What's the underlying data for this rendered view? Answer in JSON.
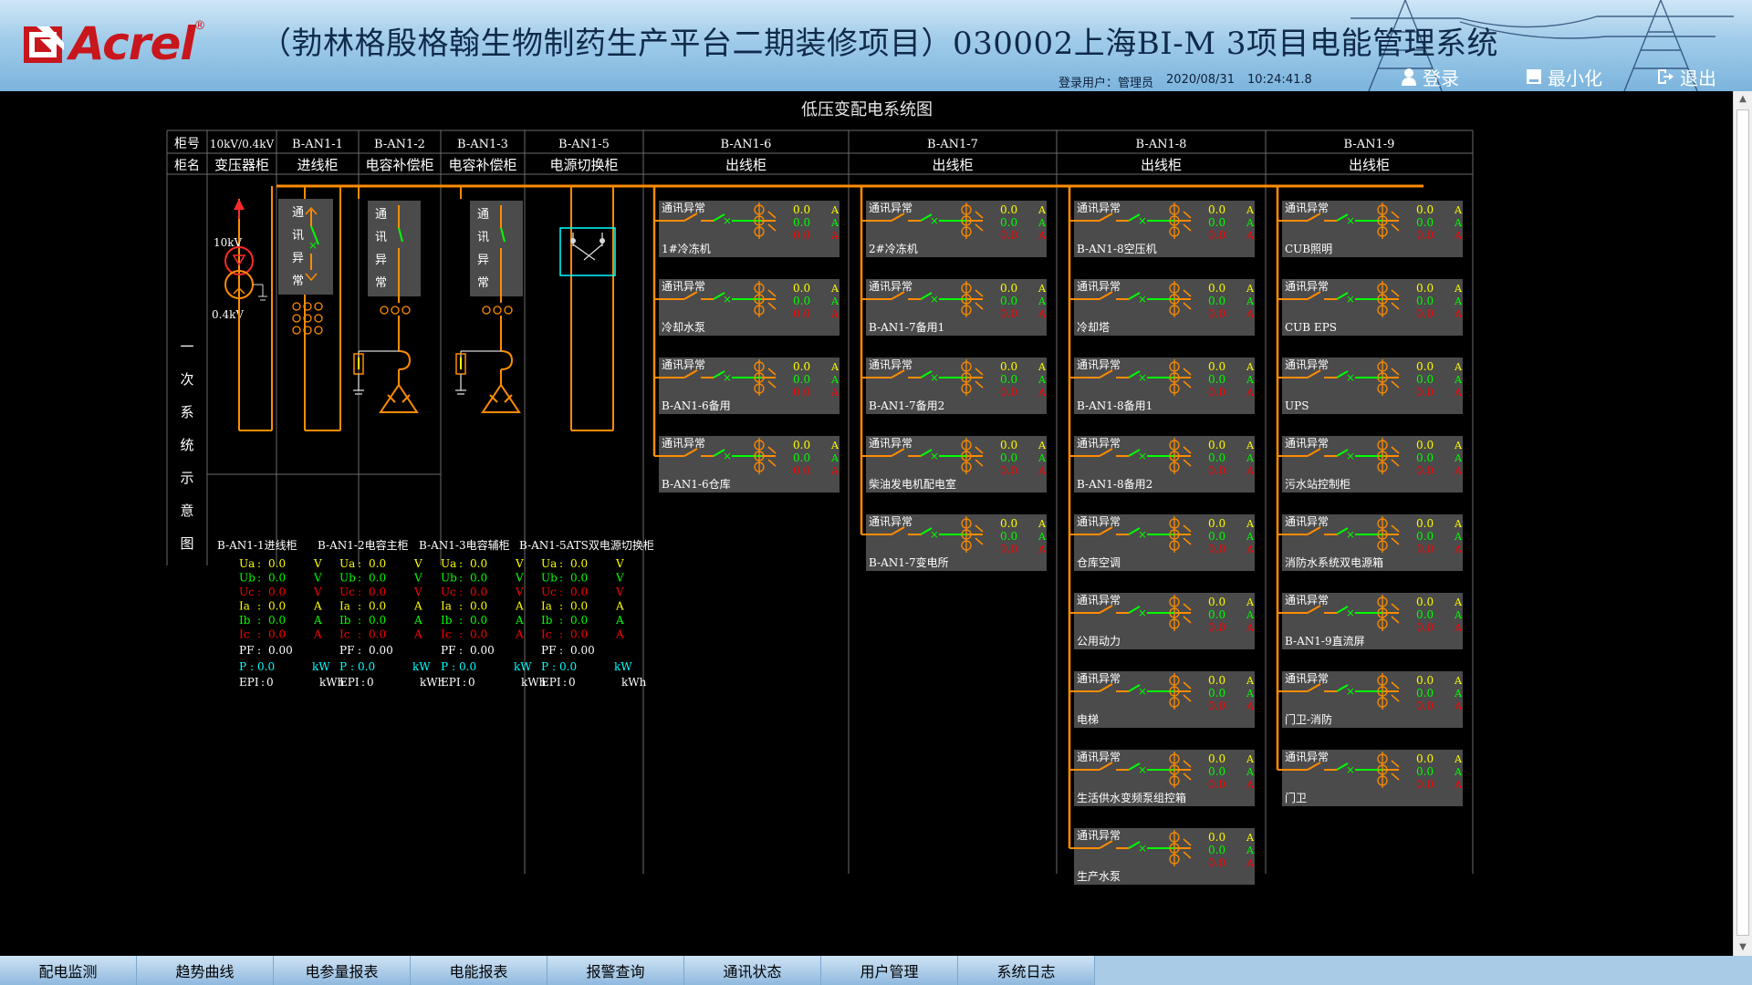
{
  "header": {
    "title": "（勃林格殷格翰生物制药生产平台二期装修项目）030002上海BI-M 3项目电能管理系统",
    "logo_text": "Acrel",
    "logo_reg": "®",
    "login_label": "登录用户：",
    "user": "管理员",
    "date": "2020/08/31",
    "time": "10:24:41.8",
    "btn_login": "登录",
    "btn_minimize": "最小化",
    "btn_exit": "退出"
  },
  "diagram": {
    "title": "低压变配电系统图",
    "row_label_no": "柜号",
    "row_label_name": "柜名",
    "side_label": [
      "一",
      "次",
      "系",
      "统",
      "示",
      "意",
      "图"
    ],
    "cabinets": [
      {
        "no": "10kV/0.4kV",
        "name": "变压器柜"
      },
      {
        "no": "B-AN1-1",
        "name": "进线柜"
      },
      {
        "no": "B-AN1-2",
        "name": "电容补偿柜"
      },
      {
        "no": "B-AN1-3",
        "name": "电容补偿柜"
      },
      {
        "no": "B-AN1-5",
        "name": "电源切换柜"
      },
      {
        "no": "B-AN1-6",
        "name": "出线柜"
      },
      {
        "no": "B-AN1-7",
        "name": "出线柜"
      },
      {
        "no": "B-AN1-8",
        "name": "出线柜"
      },
      {
        "no": "B-AN1-9",
        "name": "出线柜"
      }
    ],
    "transformer": {
      "hv": "10kV",
      "lv": "0.4kV"
    },
    "comm_fault_vertical": [
      "通",
      "讯",
      "异",
      "常"
    ],
    "comm_fault": "通讯异常",
    "feeder_values": [
      "0.0",
      "0.0",
      "0.0"
    ],
    "feeder_units": [
      "A",
      "A",
      "A"
    ],
    "feeder_colors": [
      "#ffff00",
      "#00ff00",
      "#ff0000"
    ],
    "columns": [
      {
        "feeders": [
          "1#冷冻机",
          "冷却水泵",
          "B-AN1-6备用",
          "B-AN1-6仓库"
        ]
      },
      {
        "feeders": [
          "2#冷冻机",
          "B-AN1-7备用1",
          "B-AN1-7备用2",
          "柴油发电机配电室",
          "B-AN1-7变电所"
        ]
      },
      {
        "feeders": [
          "B-AN1-8空压机",
          "冷却塔",
          "B-AN1-8备用1",
          "B-AN1-8备用2",
          "仓库空调",
          "公用动力",
          "电梯",
          "生活供水变频泵组控箱",
          "生产水泵"
        ]
      },
      {
        "feeders": [
          "CUB照明",
          "CUB EPS",
          "UPS",
          "污水站控制柜",
          "消防水系统双电源箱",
          "B-AN1-9直流屏",
          "门卫-消防",
          "门卫"
        ]
      }
    ],
    "meters": [
      {
        "title": "B-AN1-1进线柜",
        "rows": [
          {
            "k": "Ua",
            "v": "0.0",
            "u": "V",
            "c": "#ffff00"
          },
          {
            "k": "Ub",
            "v": "0.0",
            "u": "V",
            "c": "#00ff00"
          },
          {
            "k": "Uc",
            "v": "0.0",
            "u": "V",
            "c": "#ff0000"
          },
          {
            "k": "Ia",
            "v": "0.0",
            "u": "A",
            "c": "#ffff00"
          },
          {
            "k": "Ib",
            "v": "0.0",
            "u": "A",
            "c": "#00ff00"
          },
          {
            "k": "Ic",
            "v": "0.0",
            "u": "A",
            "c": "#ff0000"
          }
        ],
        "pf_label": "PF",
        "pf": "0.00",
        "p_label": "P",
        "p": "0.0",
        "p_unit": "kW",
        "epi_label": "EPI",
        "epi": "0",
        "epi_unit": "kWh"
      },
      {
        "title": "B-AN1-2电容主柜",
        "rows": [
          {
            "k": "Ua",
            "v": "0.0",
            "u": "V",
            "c": "#ffff00"
          },
          {
            "k": "Ub",
            "v": "0.0",
            "u": "V",
            "c": "#00ff00"
          },
          {
            "k": "Uc",
            "v": "0.0",
            "u": "V",
            "c": "#ff0000"
          },
          {
            "k": "Ia",
            "v": "0.0",
            "u": "A",
            "c": "#ffff00"
          },
          {
            "k": "Ib",
            "v": "0.0",
            "u": "A",
            "c": "#00ff00"
          },
          {
            "k": "Ic",
            "v": "0.0",
            "u": "A",
            "c": "#ff0000"
          }
        ],
        "pf_label": "PF",
        "pf": "0.00",
        "p_label": "P",
        "p": "0.0",
        "p_unit": "kW",
        "epi_label": "EPI",
        "epi": "0",
        "epi_unit": "kWh"
      },
      {
        "title": "B-AN1-3电容辅柜",
        "rows": [
          {
            "k": "Ua",
            "v": "0.0",
            "u": "V",
            "c": "#ffff00"
          },
          {
            "k": "Ub",
            "v": "0.0",
            "u": "V",
            "c": "#00ff00"
          },
          {
            "k": "Uc",
            "v": "0.0",
            "u": "V",
            "c": "#ff0000"
          },
          {
            "k": "Ia",
            "v": "0.0",
            "u": "A",
            "c": "#ffff00"
          },
          {
            "k": "Ib",
            "v": "0.0",
            "u": "A",
            "c": "#00ff00"
          },
          {
            "k": "Ic",
            "v": "0.0",
            "u": "A",
            "c": "#ff0000"
          }
        ],
        "pf_label": "PF",
        "pf": "0.00",
        "p_label": "P",
        "p": "0.0",
        "p_unit": "kW",
        "epi_label": "EPI",
        "epi": "0",
        "epi_unit": "kWh"
      },
      {
        "title": "B-AN1-5ATS双电源切换柜",
        "rows": [
          {
            "k": "Ua",
            "v": "0.0",
            "u": "V",
            "c": "#ffff00"
          },
          {
            "k": "Ub",
            "v": "0.0",
            "u": "V",
            "c": "#00ff00"
          },
          {
            "k": "Uc",
            "v": "0.0",
            "u": "V",
            "c": "#ff0000"
          },
          {
            "k": "Ia",
            "v": "0.0",
            "u": "A",
            "c": "#ffff00"
          },
          {
            "k": "Ib",
            "v": "0.0",
            "u": "A",
            "c": "#00ff00"
          },
          {
            "k": "Ic",
            "v": "0.0",
            "u": "A",
            "c": "#ff0000"
          }
        ],
        "pf_label": "PF",
        "pf": "0.00",
        "p_label": "P",
        "p": "0.0",
        "p_unit": "kW",
        "epi_label": "EPI",
        "epi": "0",
        "epi_unit": "kWh"
      }
    ]
  },
  "nav": [
    "配电监测",
    "趋势曲线",
    "电参量报表",
    "电能报表",
    "报警查询",
    "通讯状态",
    "用户管理",
    "系统日志"
  ],
  "colors": {
    "bus": "#ff8c00",
    "line_white": "#d8d8d8",
    "panel": "#4b4b4b",
    "green": "#00ff00",
    "red": "#ff0000",
    "yellow": "#ffff00",
    "cyan": "#00ffff"
  }
}
